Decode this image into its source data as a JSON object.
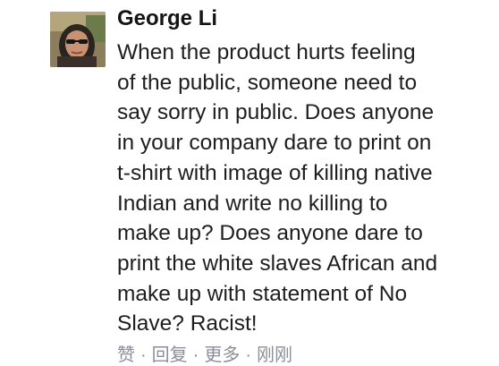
{
  "comment": {
    "author": "George Li",
    "lines": [
      "When the product hurts feeling",
      "of the public, someone need to",
      "say sorry in public. Does anyone",
      "in your company dare to print on",
      "t-shirt with image of killing native",
      "Indian and write no killing to",
      "make up? Does anyone dare to",
      "print the white slaves African and",
      "make up with statement of No",
      "Slave? Racist!"
    ],
    "actions": {
      "like": "赞",
      "reply": "回复",
      "more": "更多",
      "time": "刚刚",
      "separator": "·"
    }
  }
}
